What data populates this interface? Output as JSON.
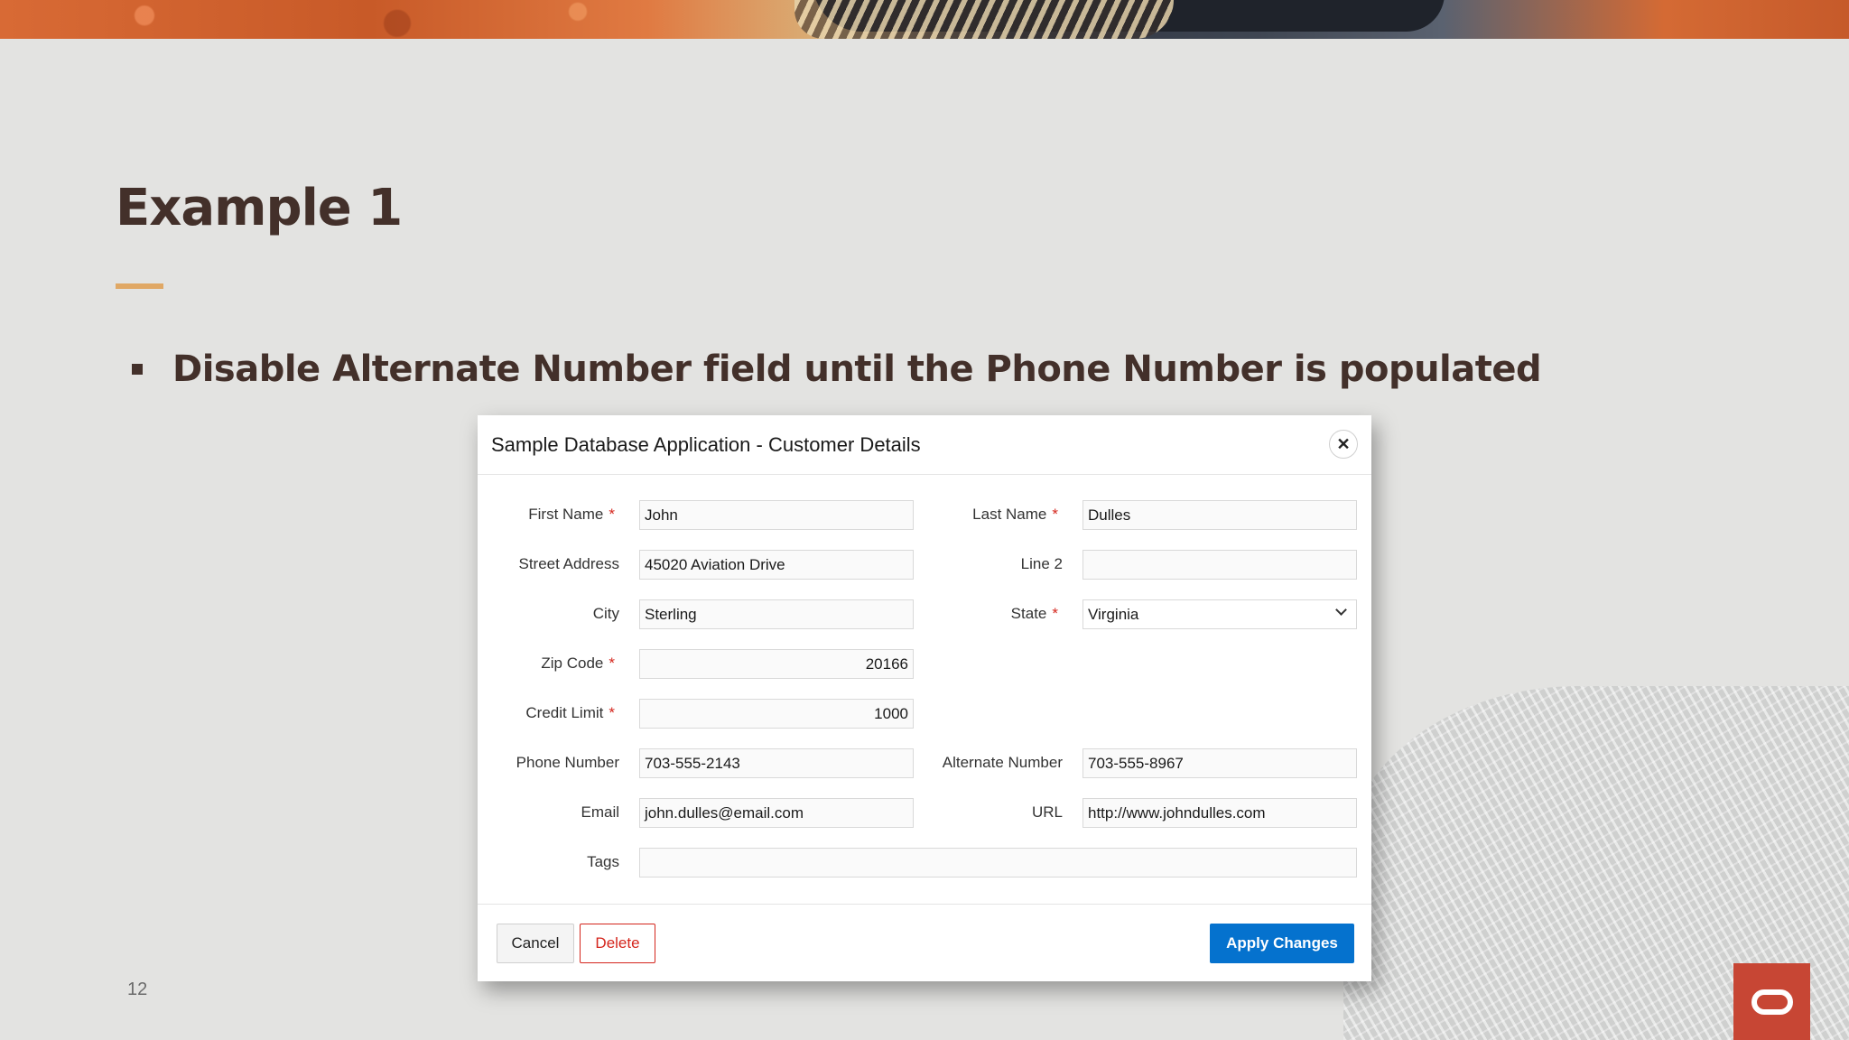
{
  "slide": {
    "title": "Example 1",
    "bullet": "Disable Alternate Number field until the Phone Number is populated",
    "page_number": "12"
  },
  "dialog": {
    "title": "Sample Database Application - Customer Details",
    "close_symbol": "✕",
    "required_marker": "*",
    "fields": {
      "first_name": {
        "label": "First Name",
        "value": "John"
      },
      "last_name": {
        "label": "Last Name",
        "value": "Dulles"
      },
      "street_address": {
        "label": "Street Address",
        "value": "45020 Aviation Drive"
      },
      "line2": {
        "label": "Line 2",
        "value": ""
      },
      "city": {
        "label": "City",
        "value": "Sterling"
      },
      "state": {
        "label": "State",
        "value": "Virginia"
      },
      "zip_code": {
        "label": "Zip Code",
        "value": "20166"
      },
      "credit_limit": {
        "label": "Credit Limit",
        "value": "1000"
      },
      "phone_number": {
        "label": "Phone Number",
        "value": "703-555-2143"
      },
      "alternate_number": {
        "label": "Alternate Number",
        "value": "703-555-8967"
      },
      "email": {
        "label": "Email",
        "value": "john.dulles@email.com"
      },
      "url": {
        "label": "URL",
        "value": "http://www.johndulles.com"
      },
      "tags": {
        "label": "Tags",
        "value": ""
      }
    },
    "buttons": {
      "cancel": "Cancel",
      "delete": "Delete",
      "apply": "Apply Changes"
    }
  },
  "colors": {
    "accent_blue": "#0572ce",
    "required_red": "#d4251c",
    "title_brown": "#43302a",
    "rule_gold": "#e0a865",
    "oracle_red": "#c74634"
  },
  "icons": {
    "close": "close-icon",
    "dropdown": "chevron-down-icon",
    "logo": "oracle-logo-icon"
  }
}
